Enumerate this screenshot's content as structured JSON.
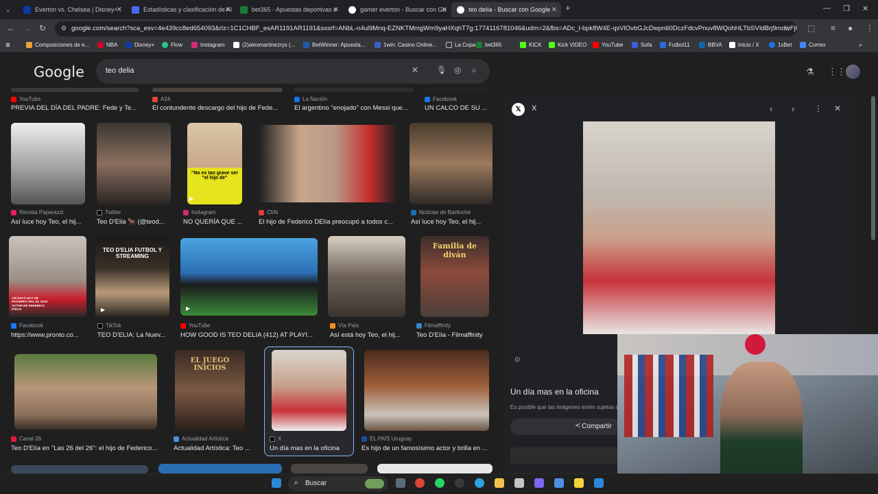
{
  "tabs": [
    {
      "title": "Everton vs. Chelsea | Disney+",
      "color": "#0e3aa6"
    },
    {
      "title": "Estadísticas y clasificación de Al",
      "color": "#4a68f0"
    },
    {
      "title": "bet365 - Apuestas deportivas e",
      "color": "#1d7a3a"
    },
    {
      "title": "gamer everton - Buscar con Go",
      "color": "#ffffff"
    },
    {
      "title": "teo delía - Buscar con Google",
      "color": "#ffffff"
    }
  ],
  "url": "google.com/search?sca_esv=4e439cc8ed654093&rlz=1C1CHBF_esAR1191AR1191&sxsrf=ANbL-n4ul9Mnq-EZNKTMmgWm9yaHXqhT7g:1774116781046&udm=2&fbs=ADc_l-bpk8W4E-qsVlOvbGJcDwpn60DczFdcvPnuv8WQohHLTbSVIdBrj9mdwFjfw...",
  "bookmarks": [
    "Composiciones de e...",
    "NBA",
    "Disney+",
    "Flow",
    "Instagram",
    "(2)alexmartinezrys (...",
    "BetWinner: Apuesta...",
    "1win: Casino Online...",
    "La Copa",
    "bet365",
    "KICK",
    "Kick VIDEO",
    "YouTube",
    "Sofa",
    "Futbol11",
    "BBVA",
    "Inicio / X",
    "1xBet",
    "Correo"
  ],
  "google": {
    "logo": "Google",
    "query": "teo delia"
  },
  "top_row": [
    {
      "source": "YouTube",
      "title": "PREVIA DEL DÍA DEL PADRE: Fede y Te..."
    },
    {
      "source": "A24",
      "title": "El contundente descargo del hijo de Fede..."
    },
    {
      "source": "La Nación",
      "title": "El argentino \"enojado\" con Messi que..."
    },
    {
      "source": "Facebook",
      "title": "UN CALCO DE SU ..."
    }
  ],
  "row2": [
    {
      "source": "Revista Paparazzi",
      "title": "Así luce hoy Teo, el hij..."
    },
    {
      "source": "Twitter",
      "title": "Teo D'Elia 🐂 (@teod..."
    },
    {
      "source": "Instagram",
      "title": "NO QUERÍA QUE ...",
      "overlay": "\"No es tan grave ser \"el hijo de\""
    },
    {
      "source": "C5N",
      "title": "El hijo de Federico DElía preocupó a todos c..."
    },
    {
      "source": "Noticias de Bariloche",
      "title": "Así luce hoy Teo, el hij..."
    }
  ],
  "row3": [
    {
      "source": "Facebook",
      "title": "https://www.pronto.co...",
      "overlay": "ASÍ ESTÁ HOY DE PACHERO TEO, EL HIJO ACTOR DE FEDERICO D'ELÍA"
    },
    {
      "source": "TikTok",
      "title": "TEO D'ELIA: La Nuev...",
      "overlay": "TEO D'ELIA FUTBOL Y STREAMING"
    },
    {
      "source": "YouTube",
      "title": "HOW GOOD IS TEO DELIA (412) AT PLAYI..."
    },
    {
      "source": "Vía País",
      "title": "Así está hoy Teo, el hij..."
    },
    {
      "source": "Filmaffinity",
      "title": "Teo D'Elía - Filmaffinity",
      "overlay": "Familia de diván"
    }
  ],
  "row4": [
    {
      "source": "Canal 26",
      "title": "Teo D'Elía en \"Las 26 del 26\": el hijo de Federico..."
    },
    {
      "source": "Actualidad Artística",
      "title": "Actualidad Artística: Teo ...",
      "overlay": "EL JUEGO INICIOS"
    },
    {
      "source": "X",
      "title": "Un día mas en la oficina"
    },
    {
      "source": "EL PAÍS Uruguay",
      "title": "Es hijo de un famosísimo actor y brilla en ..."
    }
  ],
  "panel": {
    "source": "X",
    "title": "Un día mas en la oficina",
    "disclaimer": "Es posible que las imágenes estén sujetas a",
    "share": "Compartir"
  },
  "taskbar": {
    "search": "Buscar"
  }
}
